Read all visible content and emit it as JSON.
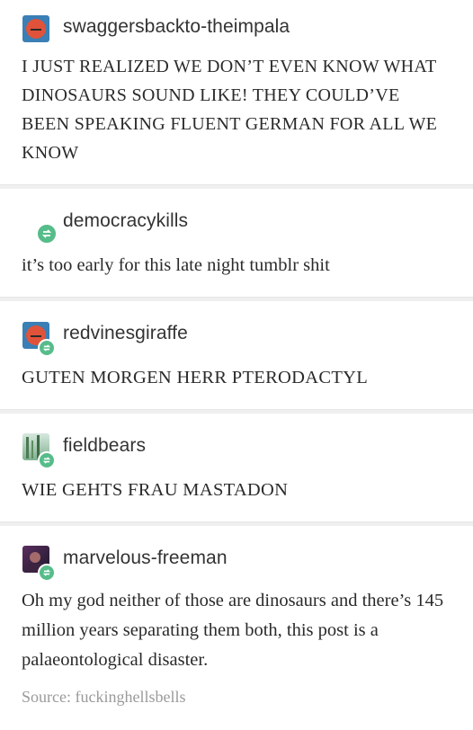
{
  "posts": [
    {
      "username": "swaggersbackto-theimpala",
      "text": "I JUST REALIZED WE DON’T EVEN KNOW WHAT DINOSAURS SOUND LIKE! THEY COULD’VE BEEN SPEAKING FLUENT GERMAN FOR ALL WE KNOW",
      "avatar_icon": "red-face-avatar"
    },
    {
      "username": "democracykills",
      "text": "it’s too early for this late night tumblr shit",
      "avatar_icon": "reblog-icon"
    },
    {
      "username": "redvinesgiraffe",
      "text": "GUTEN MORGEN HERR PTERODACTYL",
      "avatar_icon": "red-face-avatar"
    },
    {
      "username": "fieldbears",
      "text": "WIE GEHTS FRAU MASTADON",
      "avatar_icon": "forest-avatar"
    },
    {
      "username": "marvelous-freeman",
      "text": "Oh my god neither of those are dinosaurs and there’s 145 million years separating them both, this post is a palaeontological disaster.",
      "avatar_icon": "photo-avatar"
    }
  ],
  "source": "Source: fuckinghellsbells",
  "colors": {
    "reblog_green": "#56bc8a",
    "avatar_blue": "#3a7fb5",
    "avatar_red": "#e0533a"
  }
}
